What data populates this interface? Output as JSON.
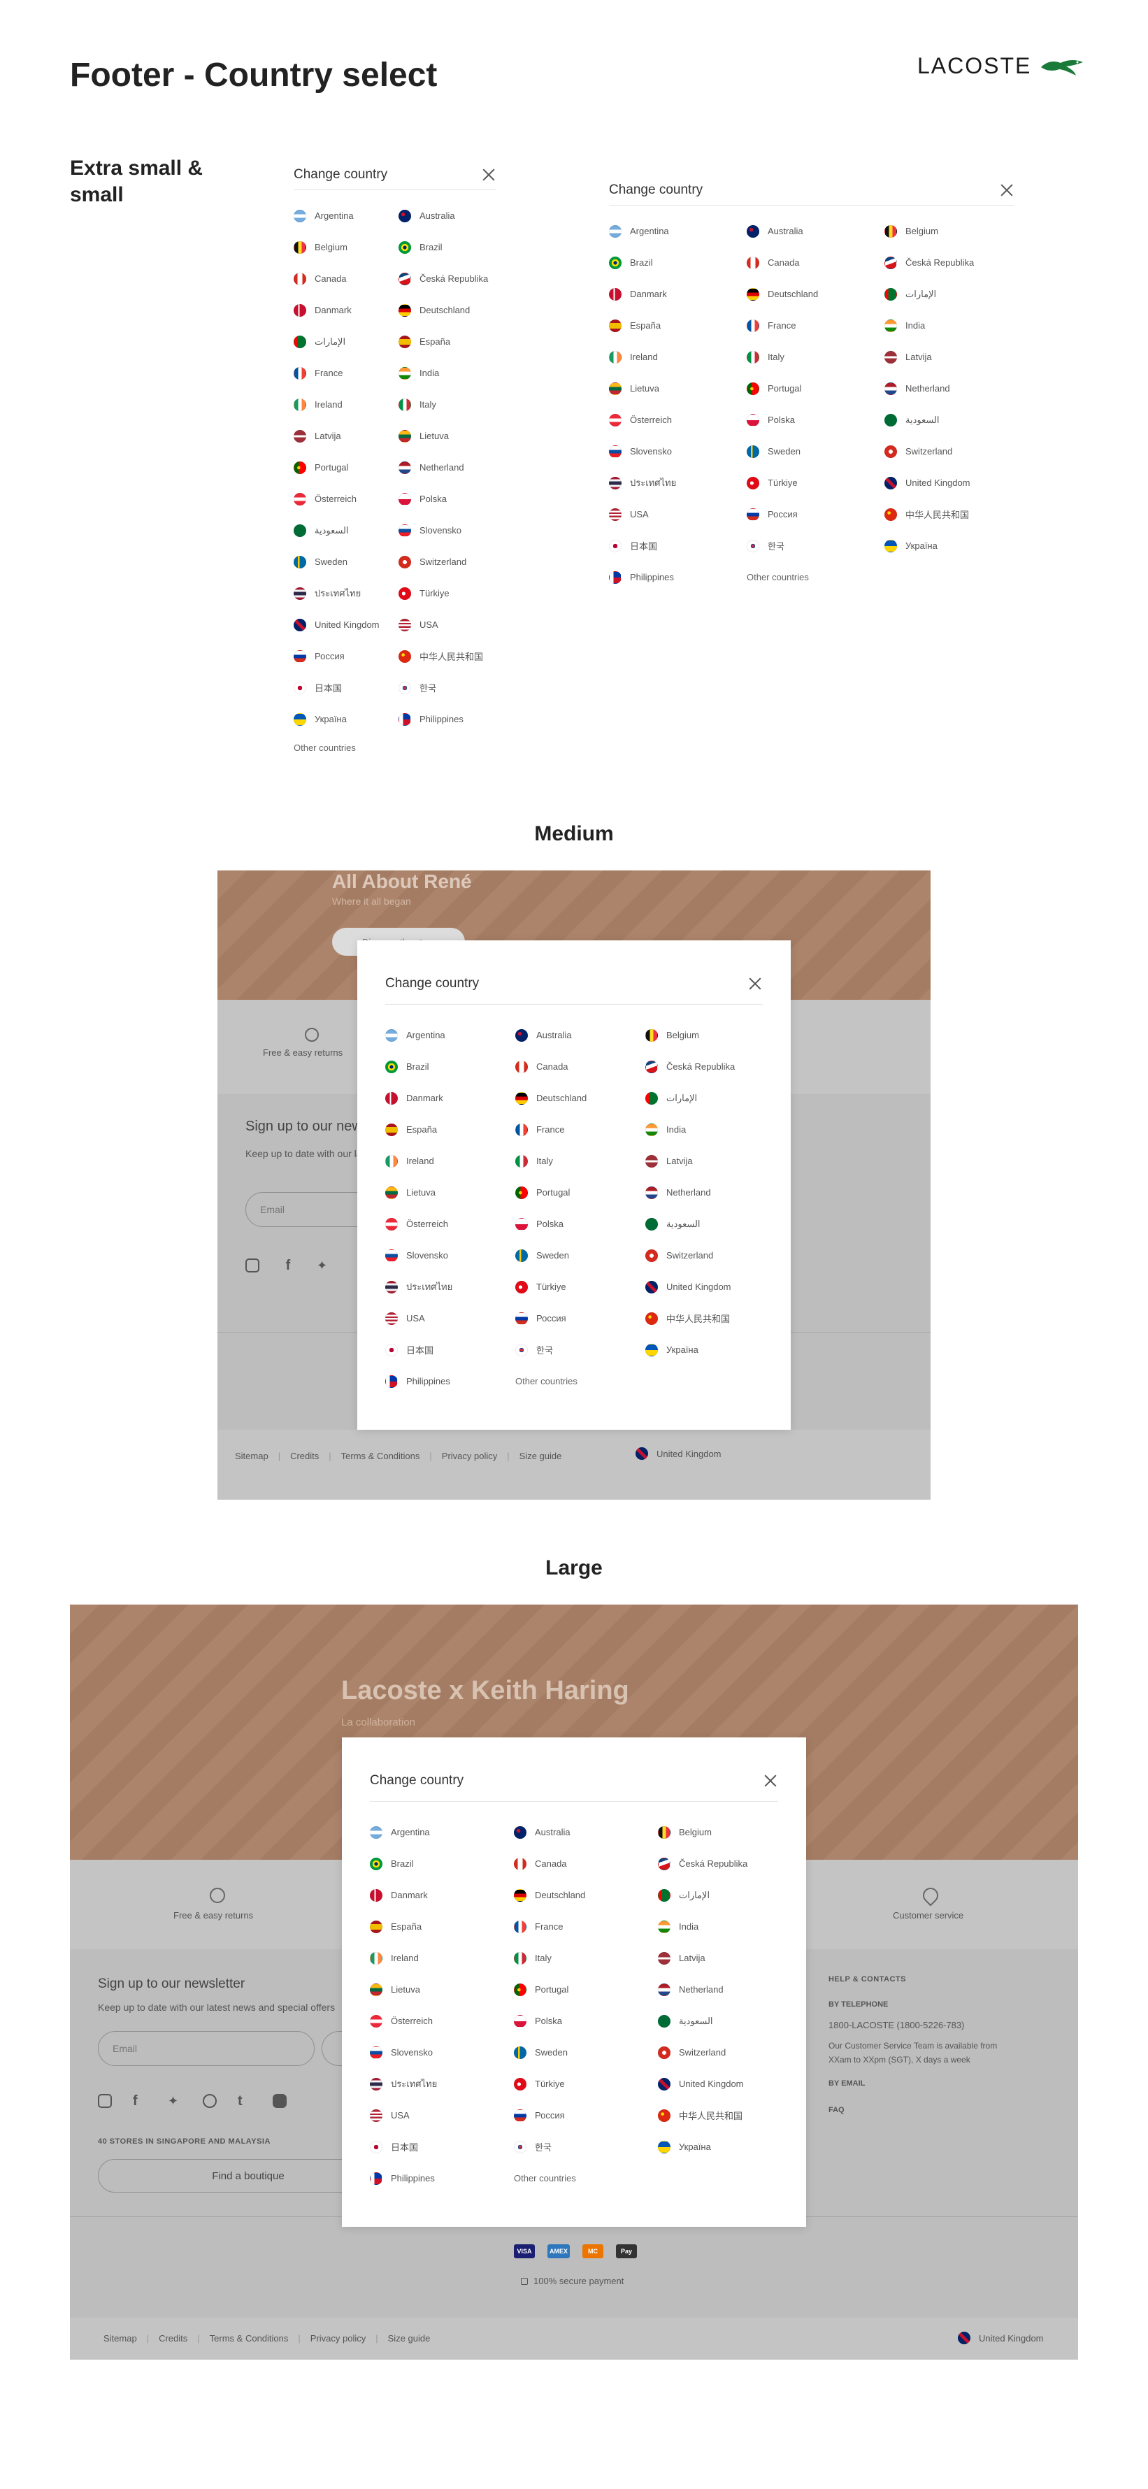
{
  "page": {
    "title": "Footer - Country select",
    "brand": "LACOSTE"
  },
  "sections": {
    "small": "Extra small &\nsmall",
    "medium": "Medium",
    "large": "Large"
  },
  "country_select": {
    "title": "Change country",
    "other": "Other countries",
    "countries_two_col": [
      {
        "name": "Argentina",
        "flag": "ar"
      },
      {
        "name": "Belgium",
        "flag": "be"
      },
      {
        "name": "Canada",
        "flag": "ca"
      },
      {
        "name": "Danmark",
        "flag": "dk"
      },
      {
        "name": "الإمارات",
        "flag": "ae"
      },
      {
        "name": "France",
        "flag": "fr"
      },
      {
        "name": "Ireland",
        "flag": "ie"
      },
      {
        "name": "Latvija",
        "flag": "lv"
      },
      {
        "name": "Portugal",
        "flag": "pt"
      },
      {
        "name": "Österreich",
        "flag": "at"
      },
      {
        "name": "السعودية",
        "flag": "sa"
      },
      {
        "name": "Sweden",
        "flag": "se"
      },
      {
        "name": "ประเทศไทย",
        "flag": "th"
      },
      {
        "name": "United Kingdom",
        "flag": "gb"
      },
      {
        "name": "Россия",
        "flag": "ru"
      },
      {
        "name": "日本国",
        "flag": "jp"
      },
      {
        "name": "Україна",
        "flag": "ua"
      },
      {
        "name": "Australia",
        "flag": "au"
      },
      {
        "name": "Brazil",
        "flag": "br"
      },
      {
        "name": "Česká Republika",
        "flag": "cz"
      },
      {
        "name": "Deutschland",
        "flag": "de"
      },
      {
        "name": "España",
        "flag": "es"
      },
      {
        "name": "India",
        "flag": "in"
      },
      {
        "name": "Italy",
        "flag": "it"
      },
      {
        "name": "Lietuva",
        "flag": "lt"
      },
      {
        "name": "Netherland",
        "flag": "nl"
      },
      {
        "name": "Polska",
        "flag": "pl"
      },
      {
        "name": "Slovensko",
        "flag": "sk"
      },
      {
        "name": "Switzerland",
        "flag": "ch"
      },
      {
        "name": "Türkiye",
        "flag": "tr"
      },
      {
        "name": "USA",
        "flag": "us"
      },
      {
        "name": "中华人民共和国",
        "flag": "cn"
      },
      {
        "name": "한국",
        "flag": "kr"
      },
      {
        "name": "Philippines",
        "flag": "ph"
      }
    ],
    "countries_three_col": [
      {
        "name": "Argentina",
        "flag": "ar"
      },
      {
        "name": "Brazil",
        "flag": "br"
      },
      {
        "name": "Danmark",
        "flag": "dk"
      },
      {
        "name": "España",
        "flag": "es"
      },
      {
        "name": "Ireland",
        "flag": "ie"
      },
      {
        "name": "Lietuva",
        "flag": "lt"
      },
      {
        "name": "Österreich",
        "flag": "at"
      },
      {
        "name": "Slovensko",
        "flag": "sk"
      },
      {
        "name": "ประเทศไทย",
        "flag": "th"
      },
      {
        "name": "USA",
        "flag": "us"
      },
      {
        "name": "日本国",
        "flag": "jp"
      },
      {
        "name": "Philippines",
        "flag": "ph"
      },
      {
        "name": "Australia",
        "flag": "au"
      },
      {
        "name": "Canada",
        "flag": "ca"
      },
      {
        "name": "Deutschland",
        "flag": "de"
      },
      {
        "name": "France",
        "flag": "fr"
      },
      {
        "name": "Italy",
        "flag": "it"
      },
      {
        "name": "Portugal",
        "flag": "pt"
      },
      {
        "name": "Polska",
        "flag": "pl"
      },
      {
        "name": "Sweden",
        "flag": "se"
      },
      {
        "name": "Türkiye",
        "flag": "tr"
      },
      {
        "name": "Россия",
        "flag": "ru"
      },
      {
        "name": "한국",
        "flag": "kr"
      },
      {
        "name": "Other countries",
        "flag": ""
      },
      {
        "name": "Belgium",
        "flag": "be"
      },
      {
        "name": "Česká Republika",
        "flag": "cz"
      },
      {
        "name": "الإمارات",
        "flag": "ae"
      },
      {
        "name": "India",
        "flag": "in"
      },
      {
        "name": "Latvija",
        "flag": "lv"
      },
      {
        "name": "Netherland",
        "flag": "nl"
      },
      {
        "name": "السعودية",
        "flag": "sa"
      },
      {
        "name": "Switzerland",
        "flag": "ch"
      },
      {
        "name": "United Kingdom",
        "flag": "gb"
      },
      {
        "name": "中华人民共和国",
        "flag": "cn"
      },
      {
        "name": "Україна",
        "flag": "ua"
      }
    ]
  },
  "medium_page": {
    "hero_title": "All About René",
    "hero_sub": "Where it all began",
    "hero_button": "Discover the story",
    "returns": "Free & easy returns",
    "newsletter_title": "Sign up to our newsletter",
    "newsletter_desc": "Keep up to date with our latest news and special offers",
    "email_placeholder": "Email",
    "links": [
      "Sitemap",
      "Credits",
      "Terms & Conditions",
      "Privacy policy",
      "Size guide"
    ],
    "country": "United Kingdom"
  },
  "large_page": {
    "hero_title": "Lacoste x Keith Haring",
    "hero_sub": "La collaboration",
    "returns": "Free & easy returns",
    "customer_service": "Customer service",
    "newsletter_title": "Sign up to our newsletter",
    "newsletter_desc": "Keep up to date with our latest news and special offers",
    "email_placeholder": "Email",
    "stores": "40 STORES IN SINGAPORE AND MALAYSIA",
    "find_boutique": "Find a boutique",
    "help_title": "HELP & CONTACTS",
    "by_phone": "BY TELEPHONE",
    "phone": "1800-LACOSTE (1800-5226-783)",
    "phone_desc": "Our Customer Service Team is available from XXam to XXpm (SGT), X days a week",
    "by_email": "BY EMAIL",
    "faq": "FAQ",
    "payments": [
      "VISA",
      "AMEX",
      "MC",
      "Pay"
    ],
    "secure": "100% secure payment",
    "links": [
      "Sitemap",
      "Credits",
      "Terms & Conditions",
      "Privacy policy",
      "Size guide"
    ],
    "country": "United Kingdom"
  },
  "flag_colors": {
    "ar": "linear-gradient(#74acdf 0 33%, #fff 33% 67%, #74acdf 67%)",
    "au": "radial-gradient(circle at 35% 35%, #c8102e 0 18%, #012169 19%)",
    "be": "linear-gradient(90deg,#111 0 33%,#fdda24 33% 67%,#ef3340 67%)",
    "br": "radial-gradient(circle,#002776 0 22%,#fedf00 23% 45%,#009c3b 46%)",
    "ca": "linear-gradient(90deg,#d52b1e 0 28%,#fff 28% 72%,#d52b1e 72%)",
    "cz": "linear-gradient(160deg,#11457e 0 30%,#fff 30% 55%,#d7141a 55%)",
    "dk": "linear-gradient(90deg,#c8102e 0 35%,#fff 35% 48%,#c8102e 48%)",
    "de": "linear-gradient(#000 0 33%,#dd0000 33% 67%,#ffce00 67%)",
    "ae": "linear-gradient(90deg,#ff0000 0 28%,#00732f 28%)",
    "es": "linear-gradient(#aa151b 0 25%,#f1bf00 25% 75%,#aa151b 75%)",
    "in": "linear-gradient(#ff9933 0 33%,#fff 33% 67%,#138808 67%)",
    "fr": "linear-gradient(90deg,#0055a4 0 33%,#fff 33% 67%,#ef4135 67%)",
    "ie": "linear-gradient(90deg,#169b62 0 33%,#fff 33% 67%,#ff883e 67%)",
    "it": "linear-gradient(90deg,#009246 0 33%,#fff 33% 67%,#ce2b37 67%)",
    "lv": "linear-gradient(#9e3039 0 40%,#fff 40% 60%,#9e3039 60%)",
    "lt": "linear-gradient(#fdb913 0 33%,#006a44 33% 67%,#c1272d 67%)",
    "pt": "radial-gradient(circle at 40% 50%,#ffcc00 0 18%,transparent 19%),linear-gradient(90deg,#006600 0 40%,#ff0000 40%)",
    "nl": "linear-gradient(#ae1c28 0 33%,#fff 33% 67%,#21468b 67%)",
    "at": "linear-gradient(#ed2939 0 33%,#fff 33% 67%,#ed2939 67%)",
    "pl": "linear-gradient(#fff 0 50%,#dc143c 50%)",
    "sa": "linear-gradient(#006c35,#006c35)",
    "sk": "linear-gradient(#fff 0 33%,#0b4ea2 33% 67%,#ee1c25 67%)",
    "se": "linear-gradient(90deg,#006aa7 0 32%,#fecc00 32% 48%,#006aa7 48%)",
    "ch": "radial-gradient(circle,#fff 0 25%,#d52b1e 26%)",
    "th": "linear-gradient(#a51931 0 17%,#f4f5f8 17% 33%,#2d2a4a 33% 67%,#f4f5f8 67% 83%,#a51931 83%)",
    "tr": "radial-gradient(circle at 40% 50%,#fff 0 20%,#e30a17 21%)",
    "gb": "linear-gradient(45deg,#012169 0 40%,#c8102e 40% 60%,#012169 60%)",
    "us": "linear-gradient(#b22234 0 15%,#fff 15% 30%,#b22234 30% 45%,#fff 45% 60%,#b22234 60% 75%,#fff 75% 90%,#b22234 90%)",
    "ru": "linear-gradient(#fff 0 33%,#0039a6 33% 67%,#d52b1e 67%)",
    "cn": "radial-gradient(circle at 35% 35%,#ffde00 0 15%,#de2910 16%)",
    "jp": "radial-gradient(circle,#bc002d 0 28%,#fff 29%)",
    "kr": "radial-gradient(circle,#cd2e3a 0 20%,#0047a0 21% 28%,#fff 29%)",
    "ua": "linear-gradient(#0057b7 0 50%,#ffd700 50%)",
    "ph": "linear-gradient(90deg,#fff 0 35%,transparent 35%),linear-gradient(#0038a8 0 50%,#ce1126 50%)"
  }
}
